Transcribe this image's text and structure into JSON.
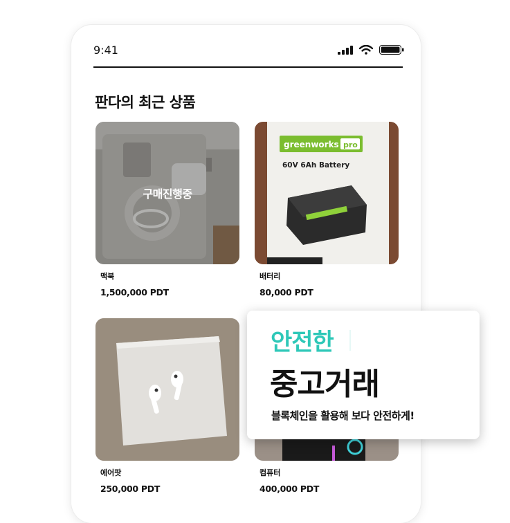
{
  "status_bar": {
    "time": "9:41"
  },
  "section_title": "판다의 최근 상품",
  "products": [
    {
      "name": "맥북",
      "price": "1,500,000 PDT",
      "overlay": "구매진행중"
    },
    {
      "name": "배터리",
      "price": "80,000 PDT",
      "image_brand": "greenworks",
      "image_brand_suffix": "pro",
      "image_caption": "60V 6Ah Battery"
    },
    {
      "name": "에어팟",
      "price": "250,000 PDT"
    },
    {
      "name": "컴퓨터",
      "price": "400,000 PDT"
    }
  ],
  "promo": {
    "accent": "안전한",
    "title": "중고거래",
    "subtitle": "블록체인을 활용해 보다 안전하게!",
    "accent_color": "#2ec8b8"
  }
}
